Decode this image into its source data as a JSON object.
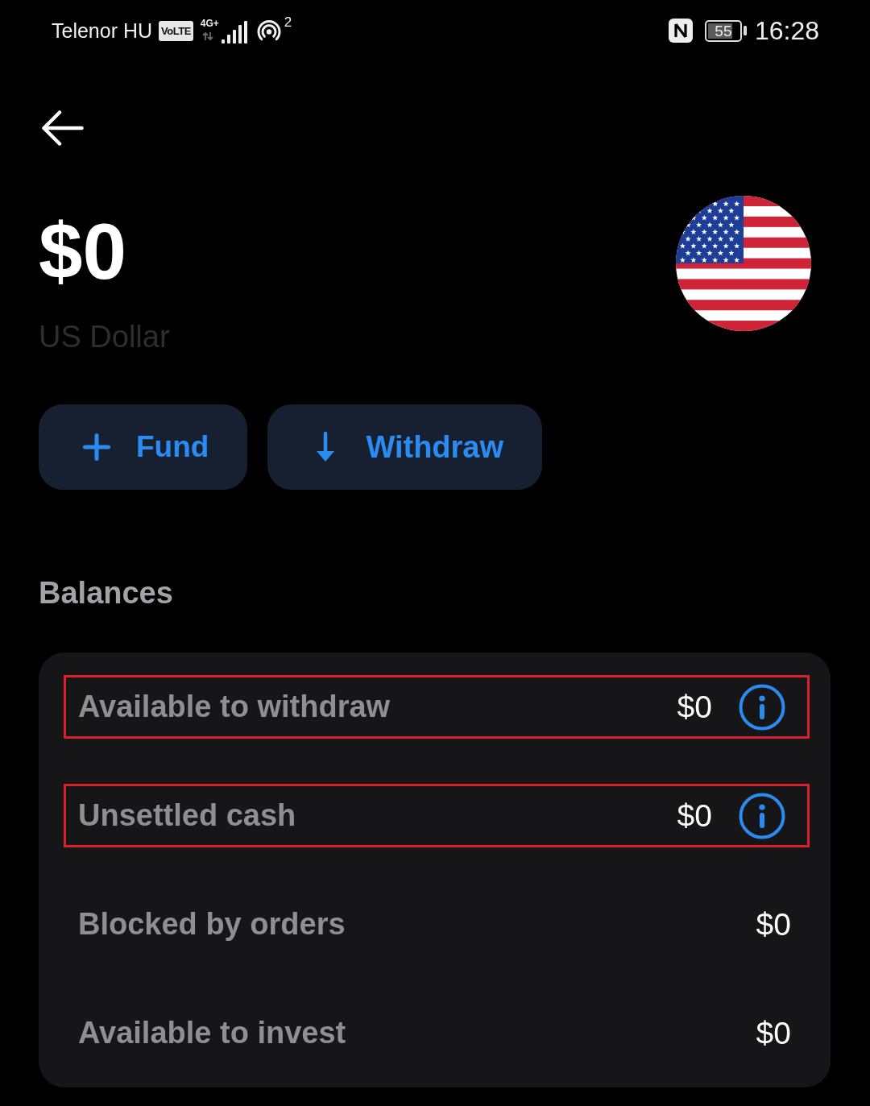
{
  "status_bar": {
    "carrier": "Telenor HU",
    "volte_badge": "VoLTE",
    "network_type": "4G+",
    "hotspot_count": "2",
    "battery_percent": "55",
    "time": "16:28"
  },
  "header": {
    "amount": "$0",
    "currency": "US Dollar"
  },
  "actions": [
    {
      "kind": "fund",
      "label": "Fund"
    },
    {
      "kind": "withdraw",
      "label": "Withdraw"
    }
  ],
  "balances": {
    "title": "Balances",
    "rows": [
      {
        "label": "Available to withdraw",
        "value": "$0",
        "info": true,
        "highlighted": true
      },
      {
        "label": "Unsettled cash",
        "value": "$0",
        "info": true,
        "highlighted": true
      },
      {
        "label": "Blocked by orders",
        "value": "$0",
        "info": false,
        "highlighted": false
      },
      {
        "label": "Available to invest",
        "value": "$0",
        "info": false,
        "highlighted": false
      }
    ]
  }
}
